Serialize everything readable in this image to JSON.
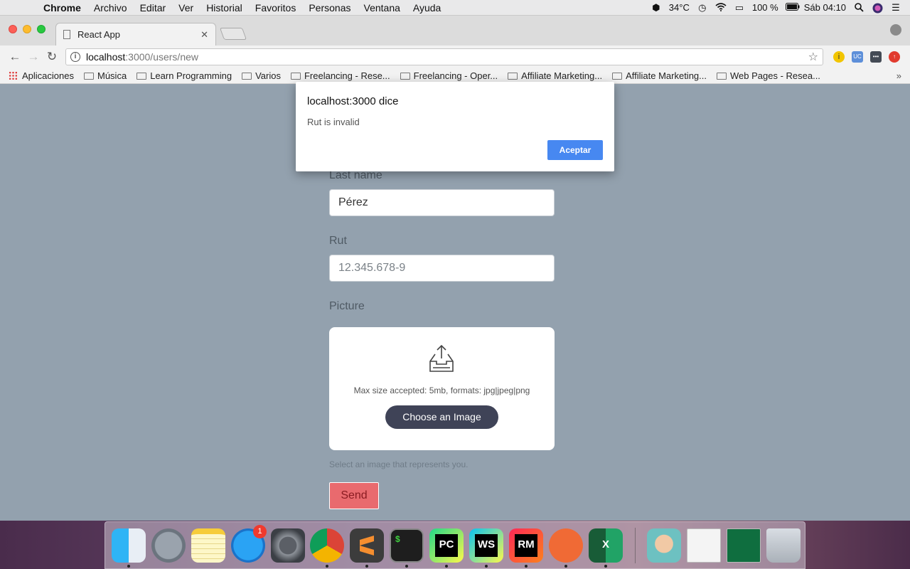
{
  "menubar": {
    "items": [
      "Chrome",
      "Archivo",
      "Editar",
      "Ver",
      "Historial",
      "Favoritos",
      "Personas",
      "Ventana",
      "Ayuda"
    ],
    "temperature": "34°C",
    "battery": "100 %",
    "clock": "Sáb 04:10"
  },
  "browser": {
    "tab_title": "React App",
    "url_host": "localhost",
    "url_path": ":3000/users/new",
    "bookmarks": [
      "Aplicaciones",
      "Música",
      "Learn Programming",
      "Varios",
      "Freelancing - Rese...",
      "Freelancing - Oper...",
      "Affiliate Marketing...",
      "Affiliate Marketing...",
      "Web Pages - Resea..."
    ],
    "bookmarks_more": "»",
    "extensions": {
      "uc": "UC"
    }
  },
  "form": {
    "last_name_label": "Last name",
    "last_name_value": "Pérez",
    "rut_label": "Rut",
    "rut_placeholder": "12.345.678-9",
    "picture_label": "Picture",
    "dropzone_text": "Max size accepted: 5mb, formats: jpg|jpeg|png",
    "choose_button": "Choose an Image",
    "help_text": "Select an image that represents you.",
    "send_button": "Send"
  },
  "dialog": {
    "title": "localhost:3000 dice",
    "message": "Rut is invalid",
    "button": "Aceptar"
  },
  "dock": {
    "badge_count": "1",
    "labels": {
      "pycharm": "PC",
      "webstorm": "WS",
      "rubymine": "RM",
      "excel": "X",
      "terminal": "$"
    }
  },
  "colors": {
    "page_bg": "#93a1ae",
    "send_button": "#e96a6e",
    "choose_button": "#3f4357",
    "dialog_button": "#4788f1"
  }
}
